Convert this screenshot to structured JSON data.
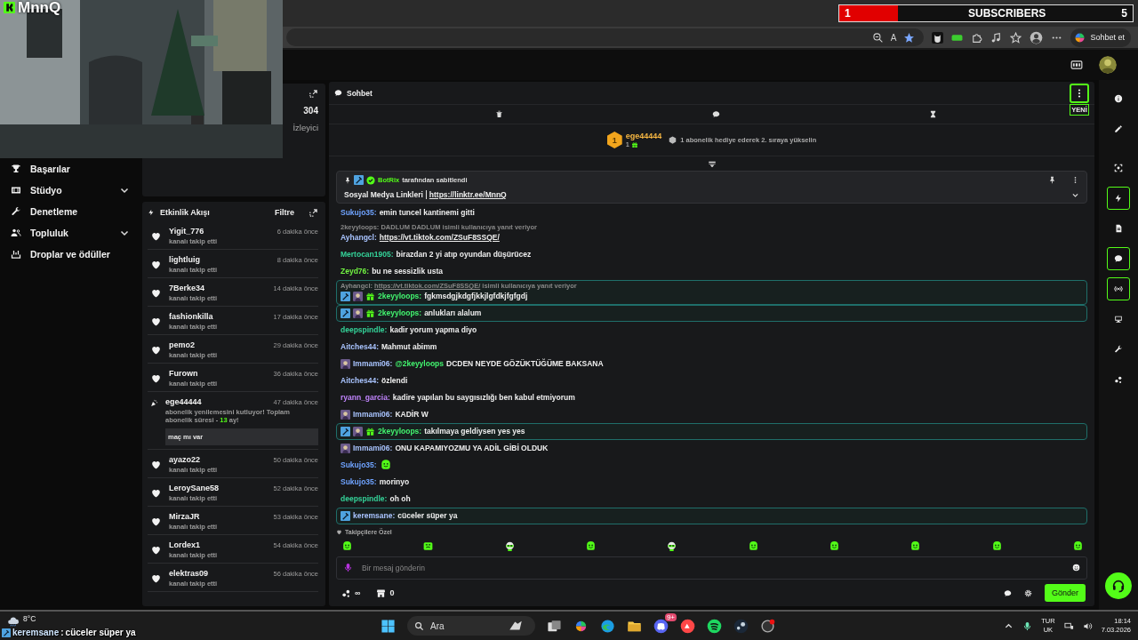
{
  "stream_overlay": {
    "logo": "MnnQ",
    "subscribers": {
      "current": "1",
      "label": "SUBSCRIBERS",
      "goal": "5",
      "level": 0.2
    }
  },
  "browser": {
    "read_aloud": "A",
    "copilot_label": "Sohbet et"
  },
  "sidebar": {
    "items": [
      {
        "label": "Başarılar",
        "has_submenu": false
      },
      {
        "label": "Stüdyo",
        "has_submenu": true
      },
      {
        "label": "Denetleme",
        "has_submenu": false
      },
      {
        "label": "Topluluk",
        "has_submenu": true
      },
      {
        "label": "Droplar ve ödüller",
        "has_submenu": false
      }
    ]
  },
  "stats": {
    "value": "304",
    "label": "İzleyici"
  },
  "activity": {
    "title": "Etkinlik Akışı",
    "filter": "Filtre",
    "events": [
      {
        "kind": "follow",
        "user": "Yigit_776",
        "time": "6 dakika önce",
        "text": "kanalı takip etti"
      },
      {
        "kind": "follow",
        "user": "lightluig",
        "time": "8 dakika önce",
        "text": "kanalı takip etti"
      },
      {
        "kind": "follow",
        "user": "7Berke34",
        "time": "14 dakika önce",
        "text": "kanalı takip etti"
      },
      {
        "kind": "follow",
        "user": "fashionkilla",
        "time": "17 dakika önce",
        "text": "kanalı takip etti"
      },
      {
        "kind": "follow",
        "user": "pemo2",
        "time": "29 dakika önce",
        "text": "kanalı takip etti"
      },
      {
        "kind": "follow",
        "user": "Furown",
        "time": "36 dakika önce",
        "text": "kanalı takip etti"
      },
      {
        "kind": "resub",
        "user": "ege44444",
        "time": "47 dakika önce",
        "text": "abonelik yenilemesini kutluyor! Toplam abonelik süresi - ",
        "months": "13",
        "suffix": " ay!",
        "quote": "maç mı var"
      },
      {
        "kind": "follow",
        "user": "ayazo22",
        "time": "50 dakika önce",
        "text": "kanalı takip etti"
      },
      {
        "kind": "follow",
        "user": "LeroySane58",
        "time": "52 dakika önce",
        "text": "kanalı takip etti"
      },
      {
        "kind": "follow",
        "user": "MirzaJR",
        "time": "53 dakika önce",
        "text": "kanalı takip etti"
      },
      {
        "kind": "follow",
        "user": "Lordex1",
        "time": "54 dakika önce",
        "text": "kanalı takip etti"
      },
      {
        "kind": "follow",
        "user": "elektras09",
        "time": "56 dakika önce",
        "text": "kanalı takip etti"
      }
    ]
  },
  "chat": {
    "title": "Sohbet",
    "new_badge": "YENİ",
    "leader": {
      "rank": "1",
      "user": "ege44444",
      "count": "1",
      "hint": "1 abonelik hediye ederek 2. sıraya yükselin"
    },
    "pinned": {
      "by": "BotRix",
      "by_suffix": "tarafından sabitlendi",
      "title": "Sosyal Medya Linkleri",
      "link": "https://linktr.ee/MnnQ"
    },
    "messages": [
      {
        "kind": "text",
        "user": "Sukujo35:",
        "color": "#6fa3ff",
        "text": "emin tuncel kantinemi gitti",
        "highlighted": false
      },
      {
        "kind": "text",
        "user": "Ayhangcl:",
        "color": "#a9c4ff",
        "reply": {
          "text": "2keyyloops: DADLUM DADLUM isimli kullanıcıya yanıt veriyor"
        },
        "link": "https://vt.tiktok.com/ZSuF8SSQE/",
        "highlighted": false
      },
      {
        "kind": "text",
        "user": "Mertocan1905:",
        "color": "#34d399",
        "text": "birazdan 2 yi atıp oyundan düşürücez",
        "highlighted": false
      },
      {
        "kind": "text",
        "user": "Zeyd76:",
        "color": "#72f542",
        "text": "bu ne sessizlik usta",
        "highlighted": false
      },
      {
        "kind": "text",
        "user": "2keyyloops:",
        "color": "#42f56f",
        "badges": [
          {
            "kind": "mod"
          },
          {
            "kind": "sub"
          },
          {
            "kind": "gift"
          }
        ],
        "reply": {
          "text": "Ayhangcl:",
          "link": "https://vt.tiktok.com/ZSuF8SSQE/",
          "suffix": "isimli kullanıcıya yanıt veriyor"
        },
        "text": "fgkmsdgjkdgfjkkjlgfdkjfgfgdj",
        "highlighted": true
      },
      {
        "kind": "text",
        "user": "2keyyloops:",
        "color": "#42f56f",
        "badges": [
          {
            "kind": "mod"
          },
          {
            "kind": "sub"
          },
          {
            "kind": "gift"
          }
        ],
        "text": "anlukları alalum",
        "highlighted": true
      },
      {
        "kind": "text",
        "user": "deepspindle:",
        "color": "#34d399",
        "text": "kadir yorum yapma diyo",
        "highlighted": false
      },
      {
        "kind": "text",
        "user": "Aitches44:",
        "color": "#a9c4ff",
        "text": "Mahmut abimm",
        "highlighted": false
      },
      {
        "kind": "text",
        "user": "Immami06:",
        "color": "#a9c4ff",
        "badges": [
          {
            "kind": "sub"
          }
        ],
        "mention": "@2keyyloops",
        "text": "DCDEN NEYDE GÖZÜKTÜĞÜME BAKSANA",
        "highlighted": false
      },
      {
        "kind": "text",
        "user": "Aitches44:",
        "color": "#a9c4ff",
        "text": "özlendi",
        "highlighted": false
      },
      {
        "kind": "text",
        "user": "ryann_garcia:",
        "color": "#c084fc",
        "text": "kadire yapılan bu saygısızlığı ben kabul etmiyorum",
        "highlighted": false
      },
      {
        "kind": "text",
        "user": "Immami06:",
        "color": "#a9c4ff",
        "badges": [
          {
            "kind": "sub"
          }
        ],
        "text": "KADİR W",
        "highlighted": false
      },
      {
        "kind": "text",
        "user": "2keyyloops:",
        "color": "#42f56f",
        "badges": [
          {
            "kind": "mod"
          },
          {
            "kind": "sub"
          },
          {
            "kind": "gift"
          }
        ],
        "text": "takılmaya geldiysen yes yes",
        "highlighted": true
      },
      {
        "kind": "text",
        "user": "Immami06:",
        "color": "#a9c4ff",
        "badges": [
          {
            "kind": "sub"
          }
        ],
        "text": "ONU KAPAMIYOZMU YA ADİL GİBİ OLDUK",
        "highlighted": false
      },
      {
        "kind": "emote",
        "user": "Sukujo35:",
        "color": "#6fa3ff",
        "highlighted": false
      },
      {
        "kind": "text",
        "user": "Sukujo35:",
        "color": "#6fa3ff",
        "text": "morinyo",
        "highlighted": false
      },
      {
        "kind": "text",
        "user": "deepspindle:",
        "color": "#34d399",
        "text": "oh oh",
        "highlighted": false
      },
      {
        "kind": "text",
        "user": "keremsane:",
        "color": "#a9c4ff",
        "badges": [
          {
            "kind": "mod"
          }
        ],
        "text": "cüceler süper ya",
        "highlighted": true
      }
    ],
    "emote_label": "Takipçilere Özel",
    "emotes": [
      {
        "kind": "blob"
      },
      {
        "kind": "box"
      },
      {
        "kind": "skull"
      },
      {
        "kind": "blob"
      },
      {
        "kind": "skull"
      },
      {
        "kind": "blob"
      },
      {
        "kind": "blob"
      },
      {
        "kind": "blob"
      },
      {
        "kind": "blob"
      },
      {
        "kind": "blob"
      }
    ],
    "input": {
      "placeholder": "Bir mesaj gönderin"
    },
    "points": "∞",
    "shop": "0",
    "send": "Gönder"
  },
  "taskbar": {
    "weather": "8°C",
    "toast": {
      "user": "keremsane",
      "sep": ":",
      "text": "cüceler süper ya"
    },
    "search": {
      "placeholder": "Ara"
    },
    "badge": "9+",
    "lang": "TUR",
    "layout": "UK",
    "time": "18:14",
    "date": "7.03.2026"
  }
}
